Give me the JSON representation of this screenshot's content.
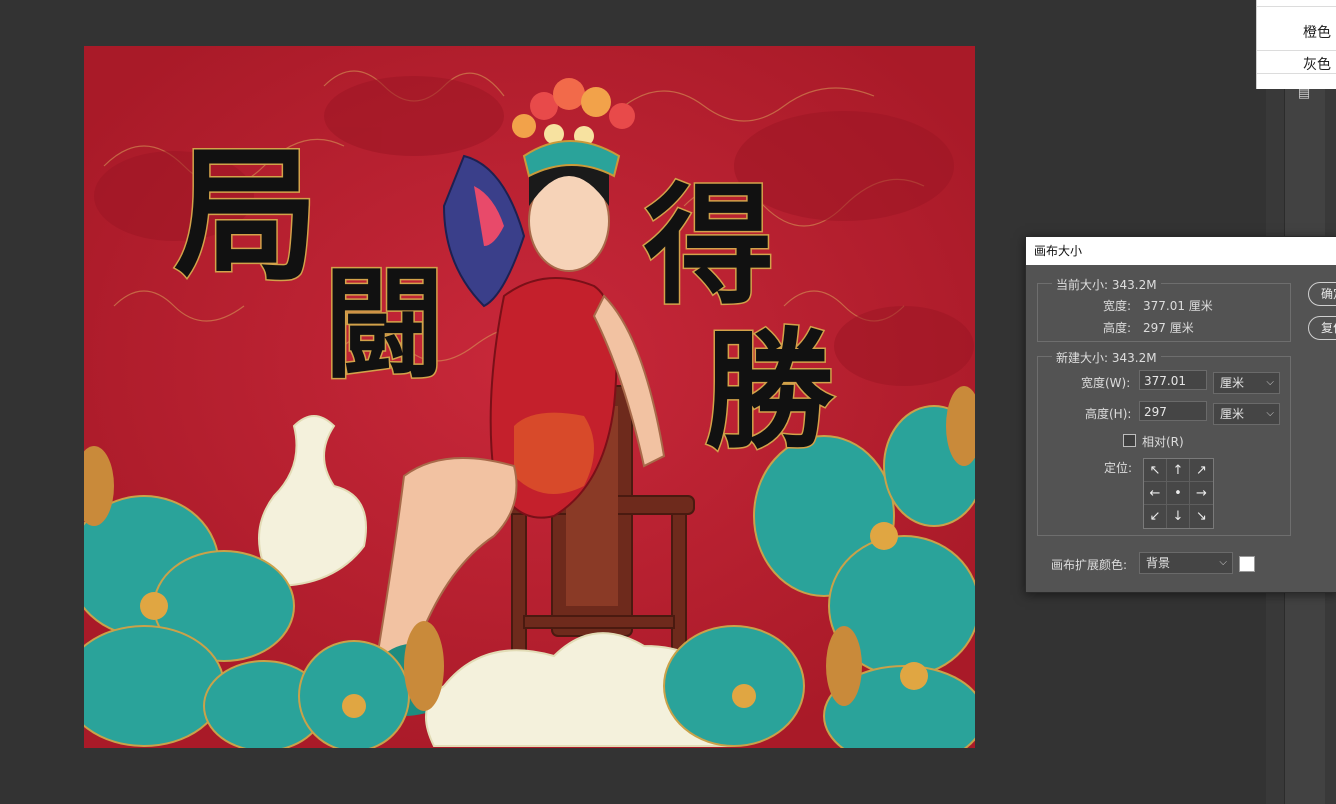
{
  "color_menu": {
    "items": [
      "橙色",
      "灰色"
    ]
  },
  "canvas": {
    "calligraphy": [
      "局",
      "闘",
      "得",
      "勝"
    ],
    "colors": {
      "background": "#b9202e",
      "teal": "#2aa39a",
      "ink": "#111111",
      "cloud": "#f4f1dc"
    }
  },
  "dialog": {
    "title": "画布大小",
    "current": {
      "label": "当前大小: 343.2M",
      "width_label": "宽度:",
      "width_value": "377.01 厘米",
      "height_label": "高度:",
      "height_value": "297 厘米"
    },
    "new": {
      "label": "新建大小: 343.2M",
      "width_label": "宽度(W):",
      "width_value": "377.01",
      "width_unit": "厘米",
      "height_label": "高度(H):",
      "height_value": "297",
      "height_unit": "厘米",
      "relative_label": "相对(R)",
      "relative_checked": false,
      "anchor_label": "定位:",
      "anchor_arrows": [
        "↖",
        "↑",
        "↗",
        "←",
        "•",
        "→",
        "↙",
        "↓",
        "↘"
      ]
    },
    "extension_color_label": "画布扩展颜色:",
    "extension_color_value": "背景",
    "extension_color_swatch": "#ffffff",
    "buttons": {
      "ok": "确定",
      "reset": "复位"
    }
  },
  "panel": {
    "icon": "document-icon"
  }
}
